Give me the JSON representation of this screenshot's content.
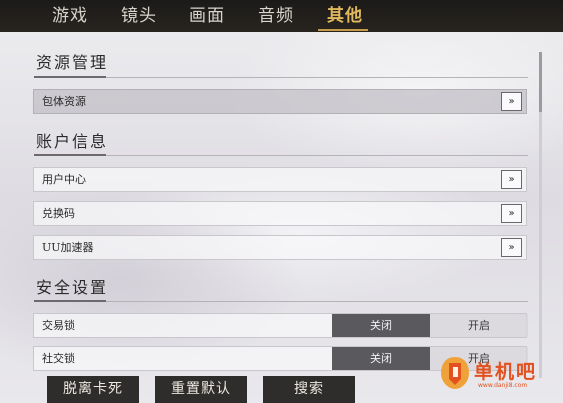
{
  "tabs": [
    {
      "label": "游戏"
    },
    {
      "label": "镜头"
    },
    {
      "label": "画面"
    },
    {
      "label": "音频"
    },
    {
      "label": "其他",
      "active": true
    }
  ],
  "sections": {
    "resources": {
      "title": "资源管理",
      "items": [
        {
          "label": "包体资源",
          "selected": true,
          "button": "»"
        }
      ]
    },
    "account": {
      "title": "账户信息",
      "items": [
        {
          "label": "用户中心",
          "button": "»"
        },
        {
          "label": "兑换码",
          "button": "»"
        },
        {
          "label": "UU加速器",
          "button": "»"
        }
      ]
    },
    "security": {
      "title": "安全设置",
      "items": [
        {
          "label": "交易锁",
          "off": "关闭",
          "on": "开启",
          "selected": "关闭"
        },
        {
          "label": "社交锁",
          "off": "关闭",
          "on": "开启",
          "selected": "关闭"
        }
      ]
    }
  },
  "bottom_buttons": {
    "unstuck": "脱离卡死",
    "reset": "重置默认",
    "search": "搜索"
  },
  "watermark": {
    "text": "单机吧",
    "url": "www.danji8.com"
  },
  "colors": {
    "accent": "#e0b85e",
    "toggle_selected": "#5a5a5e",
    "watermark": "#e2511f"
  }
}
